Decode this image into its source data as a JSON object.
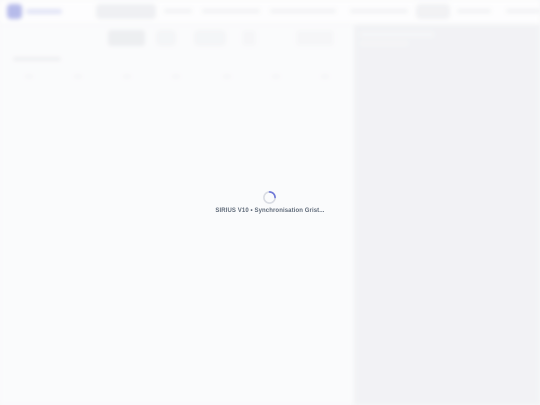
{
  "loading": {
    "message": "SIRIUS V10 • Synchronisation Grist...",
    "spinner_icon": "spinner-icon"
  },
  "colors": {
    "accent": "#6f78d8",
    "page_bg": "#f4f5f7",
    "side_panel_bg": "#e9eaee",
    "loading_text": "#5f6a79",
    "spinner_active": "#6f78d8",
    "spinner_track": "#d9dce3"
  }
}
